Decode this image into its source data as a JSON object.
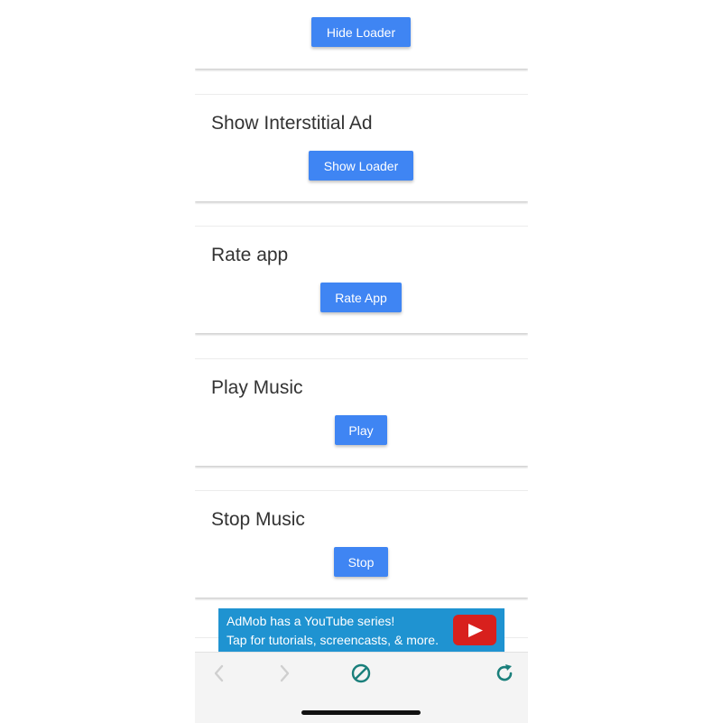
{
  "cards": [
    {
      "title": "",
      "button": "Hide Loader"
    },
    {
      "title": "Show Interstitial Ad",
      "button": "Show Loader"
    },
    {
      "title": "Rate app",
      "button": "Rate App"
    },
    {
      "title": "Play Music",
      "button": "Play"
    },
    {
      "title": "Stop Music",
      "button": "Stop"
    }
  ],
  "ad": {
    "line1": "AdMob has a YouTube series!",
    "line2": "Tap for tutorials, screencasts, & more.",
    "icon": "youtube-play-icon",
    "background": "#1f93d1"
  },
  "toolbar": {
    "icons": [
      "back-arrow-icon",
      "forward-arrow-icon",
      "stop-icon",
      "reload-icon"
    ],
    "accent": "#1a7f7b"
  },
  "colors": {
    "button": "#3f85f3"
  }
}
